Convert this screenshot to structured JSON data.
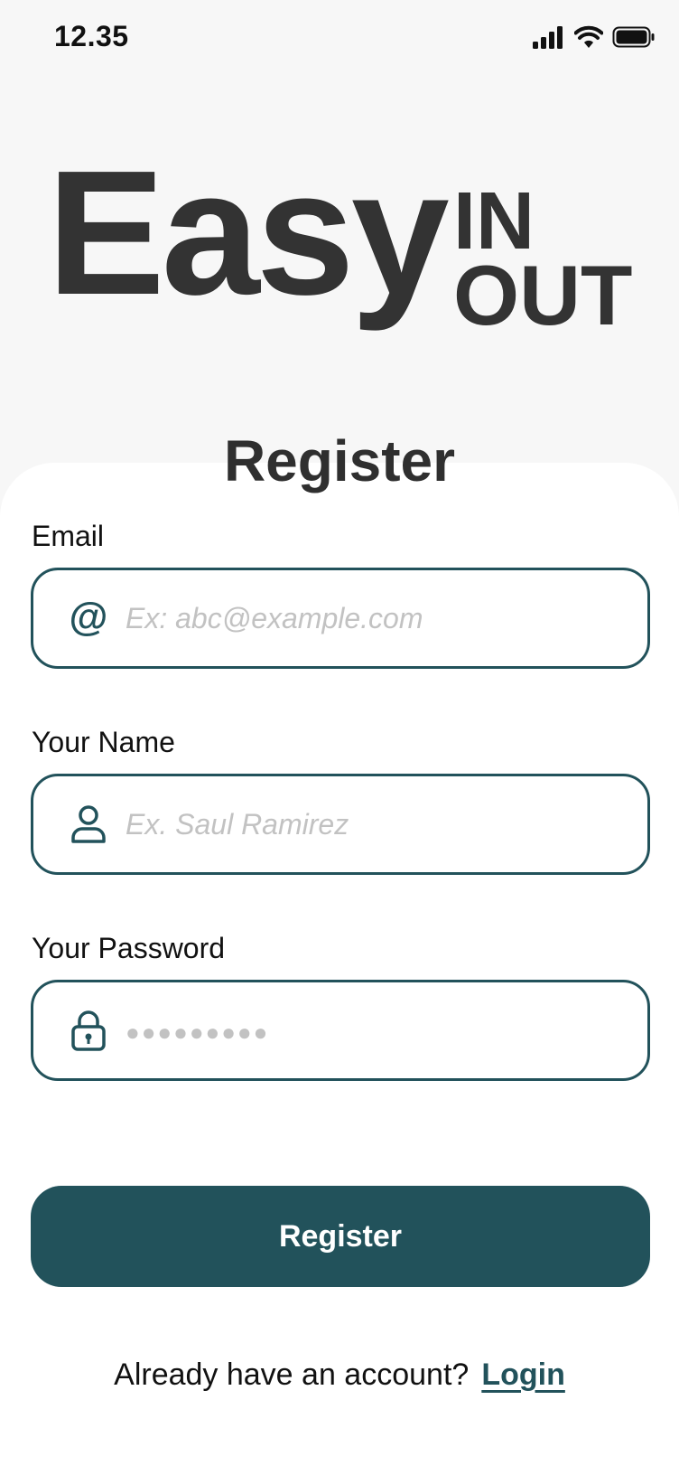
{
  "status_bar": {
    "time": "12.35",
    "icons": [
      "signal-icon",
      "wifi-icon",
      "battery-icon"
    ]
  },
  "logo": {
    "main": "Easy",
    "top": "IN",
    "bottom": "OUT"
  },
  "form": {
    "title": "Register",
    "email": {
      "label": "Email",
      "placeholder": "Ex: abc@example.com",
      "icon": "at-icon"
    },
    "name": {
      "label": "Your Name",
      "placeholder": "Ex. Saul Ramirez",
      "icon": "user-icon"
    },
    "password": {
      "label": "Your Password",
      "placeholder": "●●●●●●●●●",
      "icon": "lock-icon"
    },
    "submit_label": "Register"
  },
  "footer": {
    "prompt": "Already have an account?",
    "login_label": "Login"
  },
  "colors": {
    "accent": "#22525b",
    "background": "#f7f7f7",
    "card": "#ffffff",
    "text_dark": "#333333",
    "placeholder": "#c2c2c2"
  }
}
